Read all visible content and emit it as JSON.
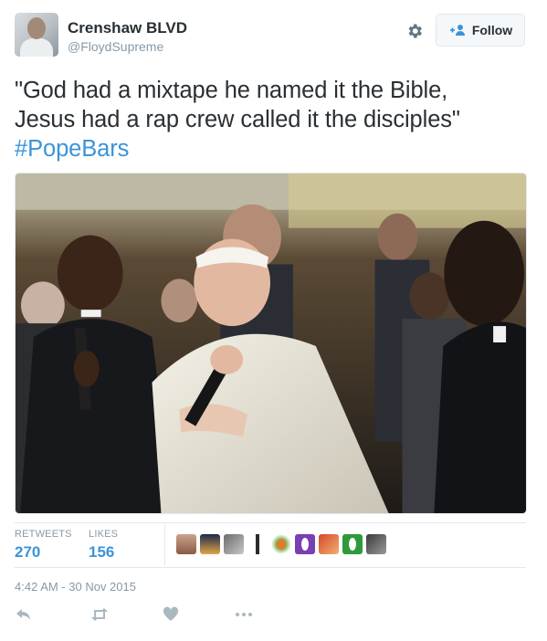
{
  "user": {
    "name": "Crenshaw BLVD",
    "handle": "@FloydSupreme"
  },
  "follow_button": {
    "label": "Follow"
  },
  "tweet": {
    "line1": "\"God had a mixtape he named it the Bible,",
    "line2": "Jesus had a rap crew called it the disciples\"",
    "hashtag": "#PopeBars"
  },
  "stats": {
    "retweets_label": "RETWEETS",
    "retweets_value": "270",
    "likes_label": "LIKES",
    "likes_value": "156"
  },
  "timestamp": "4:42 AM - 30 Nov 2015",
  "icons": {
    "settings": "gear-icon",
    "follow": "add-user-icon",
    "reply": "reply-icon",
    "retweet": "retweet-icon",
    "like": "heart-icon",
    "more": "more-icon"
  },
  "colors": {
    "link": "#3b94d9",
    "muted": "#8899a6",
    "text": "#292f33",
    "border": "#e1e8ed"
  }
}
